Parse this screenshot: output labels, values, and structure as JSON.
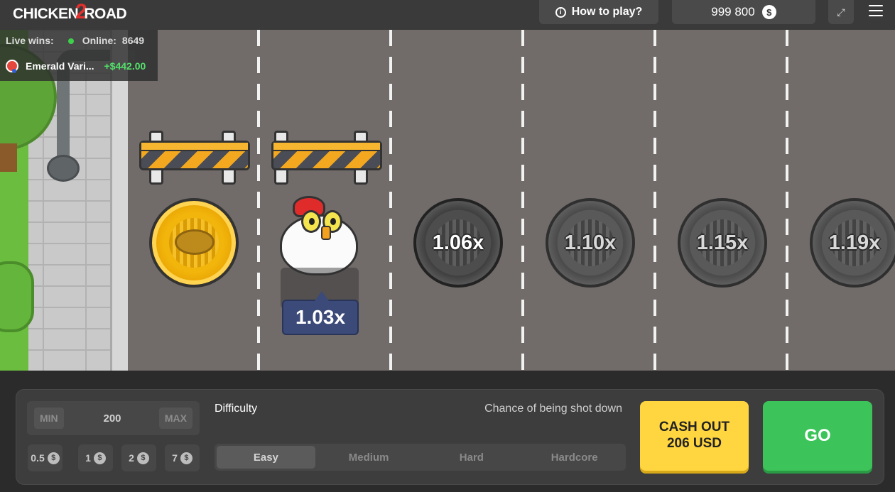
{
  "header": {
    "logo_part1": "CHICKEN",
    "logo_part2": "2",
    "logo_part3": "ROAD",
    "how_to_play_label": "How to play?",
    "balance": "999 800",
    "currency_symbol": "$"
  },
  "live": {
    "live_wins_label": "Live wins:",
    "online_label": "Online:",
    "online_count": "8649",
    "latest_win_player": "Emerald Vari...",
    "latest_win_amount": "+$442.00"
  },
  "game": {
    "current_multiplier": "1.03x",
    "multipliers": [
      "1.06x",
      "1.10x",
      "1.15x",
      "1.19x"
    ]
  },
  "controls": {
    "min_label": "MIN",
    "max_label": "MAX",
    "bet_value": "200",
    "chips": [
      "0.5",
      "1",
      "2",
      "7"
    ],
    "difficulty_label": "Difficulty",
    "chance_label": "Chance of being shot down",
    "difficulties": [
      "Easy",
      "Medium",
      "Hard",
      "Hardcore"
    ],
    "selected_difficulty": "Easy",
    "cashout_line1": "CASH OUT",
    "cashout_line2": "206 USD",
    "go_label": "GO"
  },
  "colors": {
    "accent_yellow": "#ffd63f",
    "go_green": "#3cc45a",
    "win_green": "#52e06a",
    "multiplier_tag": "#3b4a78"
  }
}
